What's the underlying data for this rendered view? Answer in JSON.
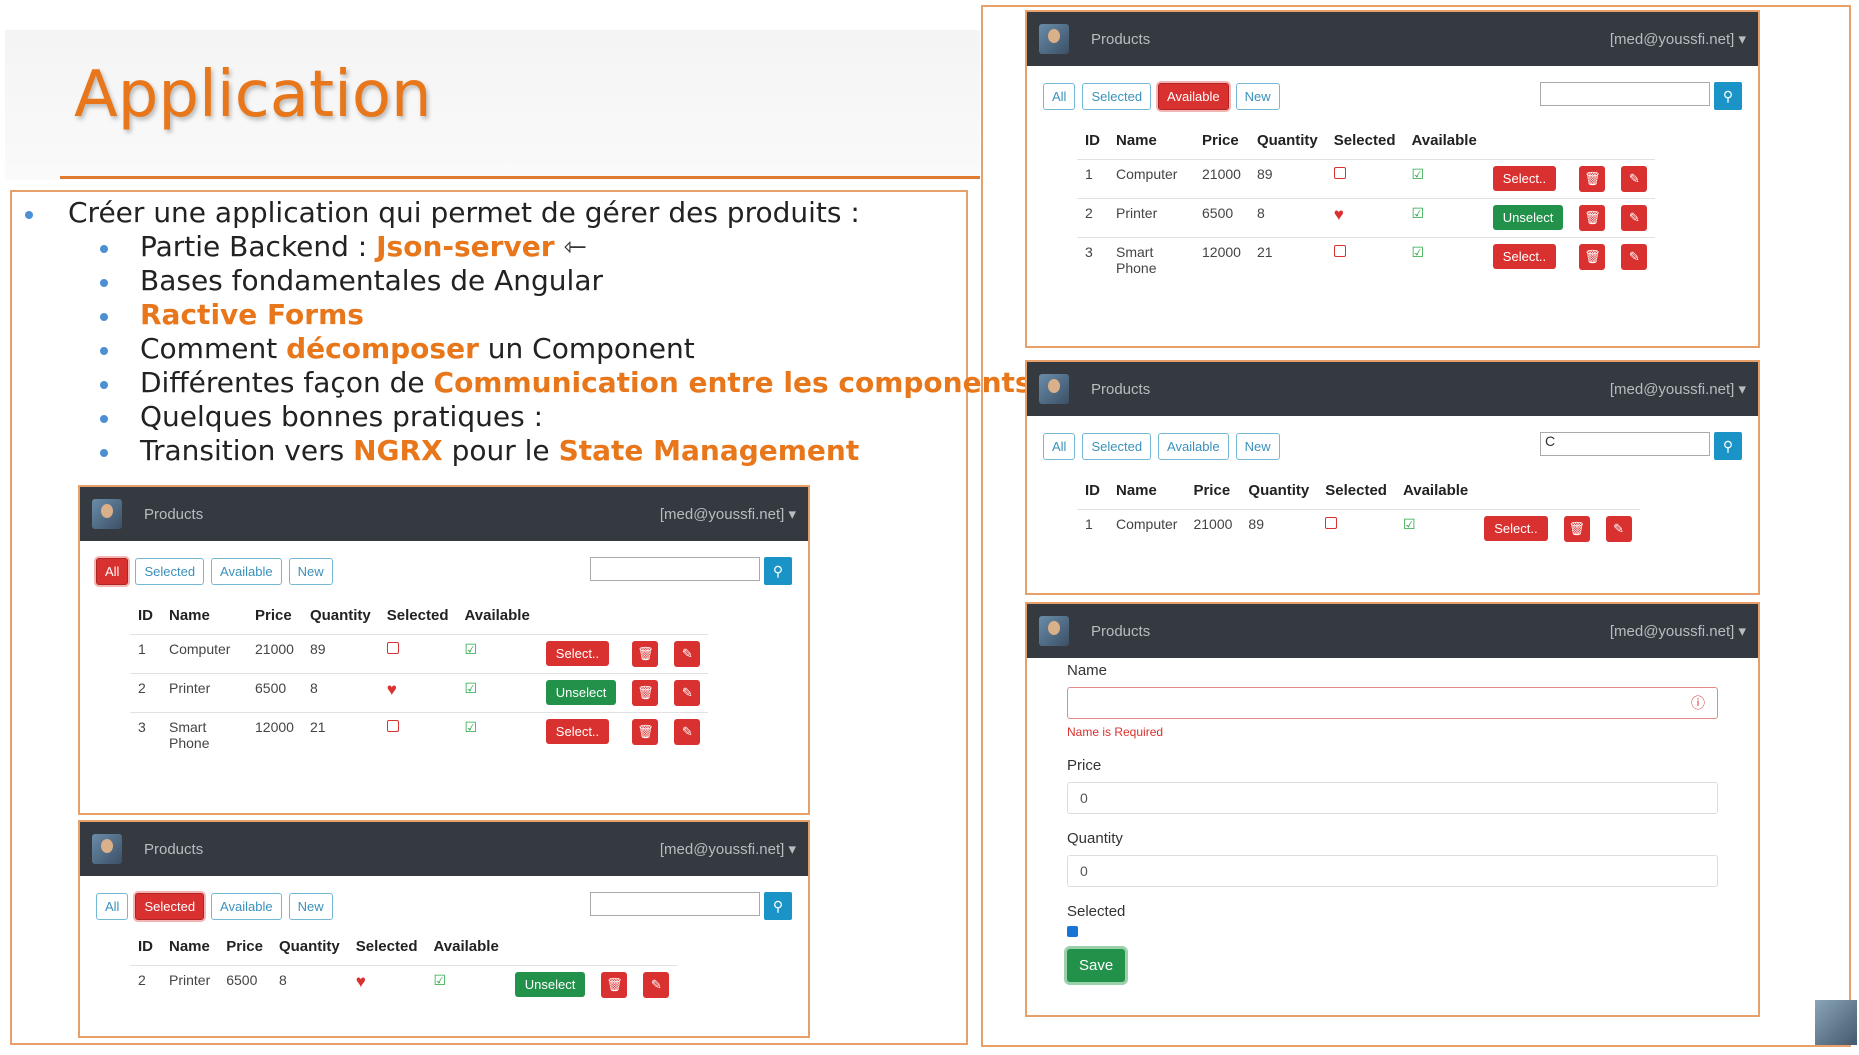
{
  "slide_title": "Application",
  "bullets": {
    "main": "Créer une application qui permet de gérer des produits :",
    "items": [
      {
        "pre": "Partie Backend : ",
        "hl": "Json-server",
        "post": ""
      },
      {
        "pre": "Bases fondamentales de Angular",
        "hl": "",
        "post": ""
      },
      {
        "pre": "",
        "hl": "Ractive Forms",
        "post": ""
      },
      {
        "pre": "Comment ",
        "hl": "décomposer",
        "post": " un Component"
      },
      {
        "pre": "Différentes façon de ",
        "hl": "Communication entre les components",
        "post": ""
      },
      {
        "pre": "Quelques bonnes pratiques :",
        "hl": "",
        "post": ""
      },
      {
        "pre": "Transition vers ",
        "hl": "NGRX",
        "post": " pour le "
      },
      {
        "hl2": "State Management"
      }
    ]
  },
  "nav": {
    "title": "Products",
    "user": "[med@youssfi.net]",
    "caret": "▾"
  },
  "filters": [
    "All",
    "Selected",
    "Available",
    "New"
  ],
  "headers": [
    "ID",
    "Name",
    "Price",
    "Quantity",
    "Selected",
    "Available"
  ],
  "buttons": {
    "select": "Select..",
    "unselect": "Unselect"
  },
  "search_value": "C",
  "rows": {
    "computer": {
      "id": "1",
      "name": "Computer",
      "price": "21000",
      "qty": "89"
    },
    "printer": {
      "id": "2",
      "name": "Printer",
      "price": "6500",
      "qty": "8"
    },
    "phone": {
      "id": "3",
      "name": "Smart Phone",
      "price": "12000",
      "qty": "21"
    }
  },
  "form": {
    "name_label": "Name",
    "name_error": "Name is Required",
    "price_label": "Price",
    "price_value": "0",
    "qty_label": "Quantity",
    "qty_value": "0",
    "selected_label": "Selected",
    "save": "Save"
  },
  "colors": {
    "accent": "#e8761a",
    "danger": "#d9312f",
    "success": "#229149",
    "info": "#1a93c6",
    "nav": "#343a40"
  }
}
